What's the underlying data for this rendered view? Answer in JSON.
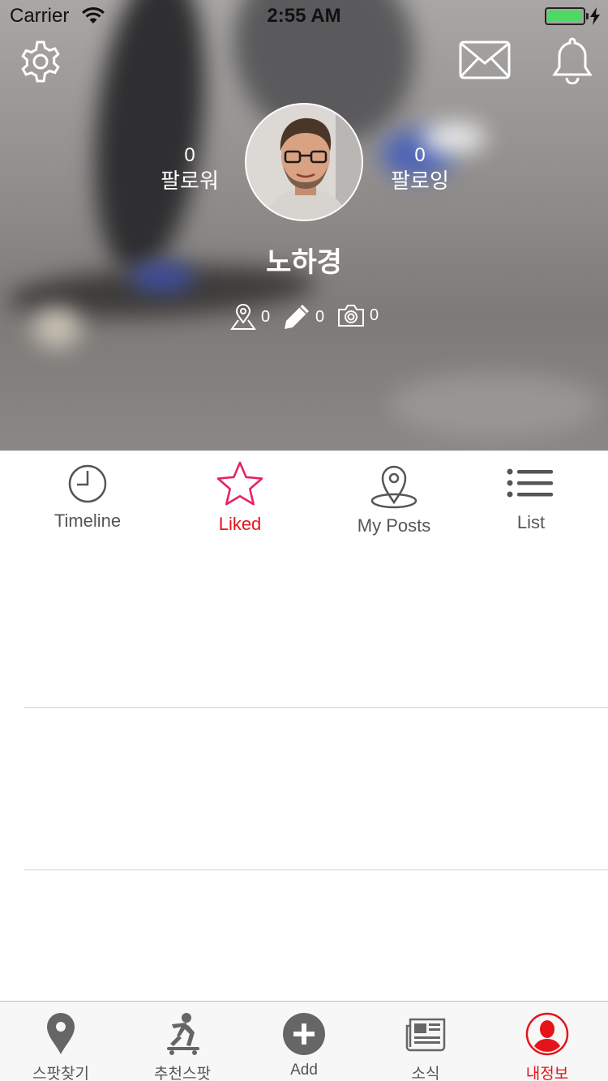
{
  "status_bar": {
    "carrier": "Carrier",
    "time": "2:55 AM",
    "battery_color": "#4cd964"
  },
  "profile": {
    "followers_count": "0",
    "followers_label": "팔로워",
    "following_count": "0",
    "following_label": "팔로잉",
    "username": "노하경",
    "places_count": "0",
    "posts_count": "0",
    "photos_count": "0"
  },
  "header_icons": {
    "settings": "gear-icon",
    "messages": "mail-icon",
    "notifications": "bell-icon"
  },
  "tabs": [
    {
      "label": "Timeline",
      "icon": "clock-icon",
      "active": false
    },
    {
      "label": "Liked",
      "icon": "star-icon",
      "active": true
    },
    {
      "label": "My Posts",
      "icon": "map-pin-icon",
      "active": false
    },
    {
      "label": "List",
      "icon": "list-icon",
      "active": false
    }
  ],
  "tab_bar": [
    {
      "label": "스팟찾기",
      "icon": "location-pin-icon",
      "active": false
    },
    {
      "label": "추천스팟",
      "icon": "skateboarder-icon",
      "active": false
    },
    {
      "label": "Add",
      "icon": "plus-circle-icon",
      "active": false
    },
    {
      "label": "소식",
      "icon": "newspaper-icon",
      "active": false
    },
    {
      "label": "내정보",
      "icon": "profile-icon",
      "active": true
    }
  ],
  "colors": {
    "accent": "#e5141b",
    "liked_star": "#e8206a",
    "inactive": "#555555"
  }
}
